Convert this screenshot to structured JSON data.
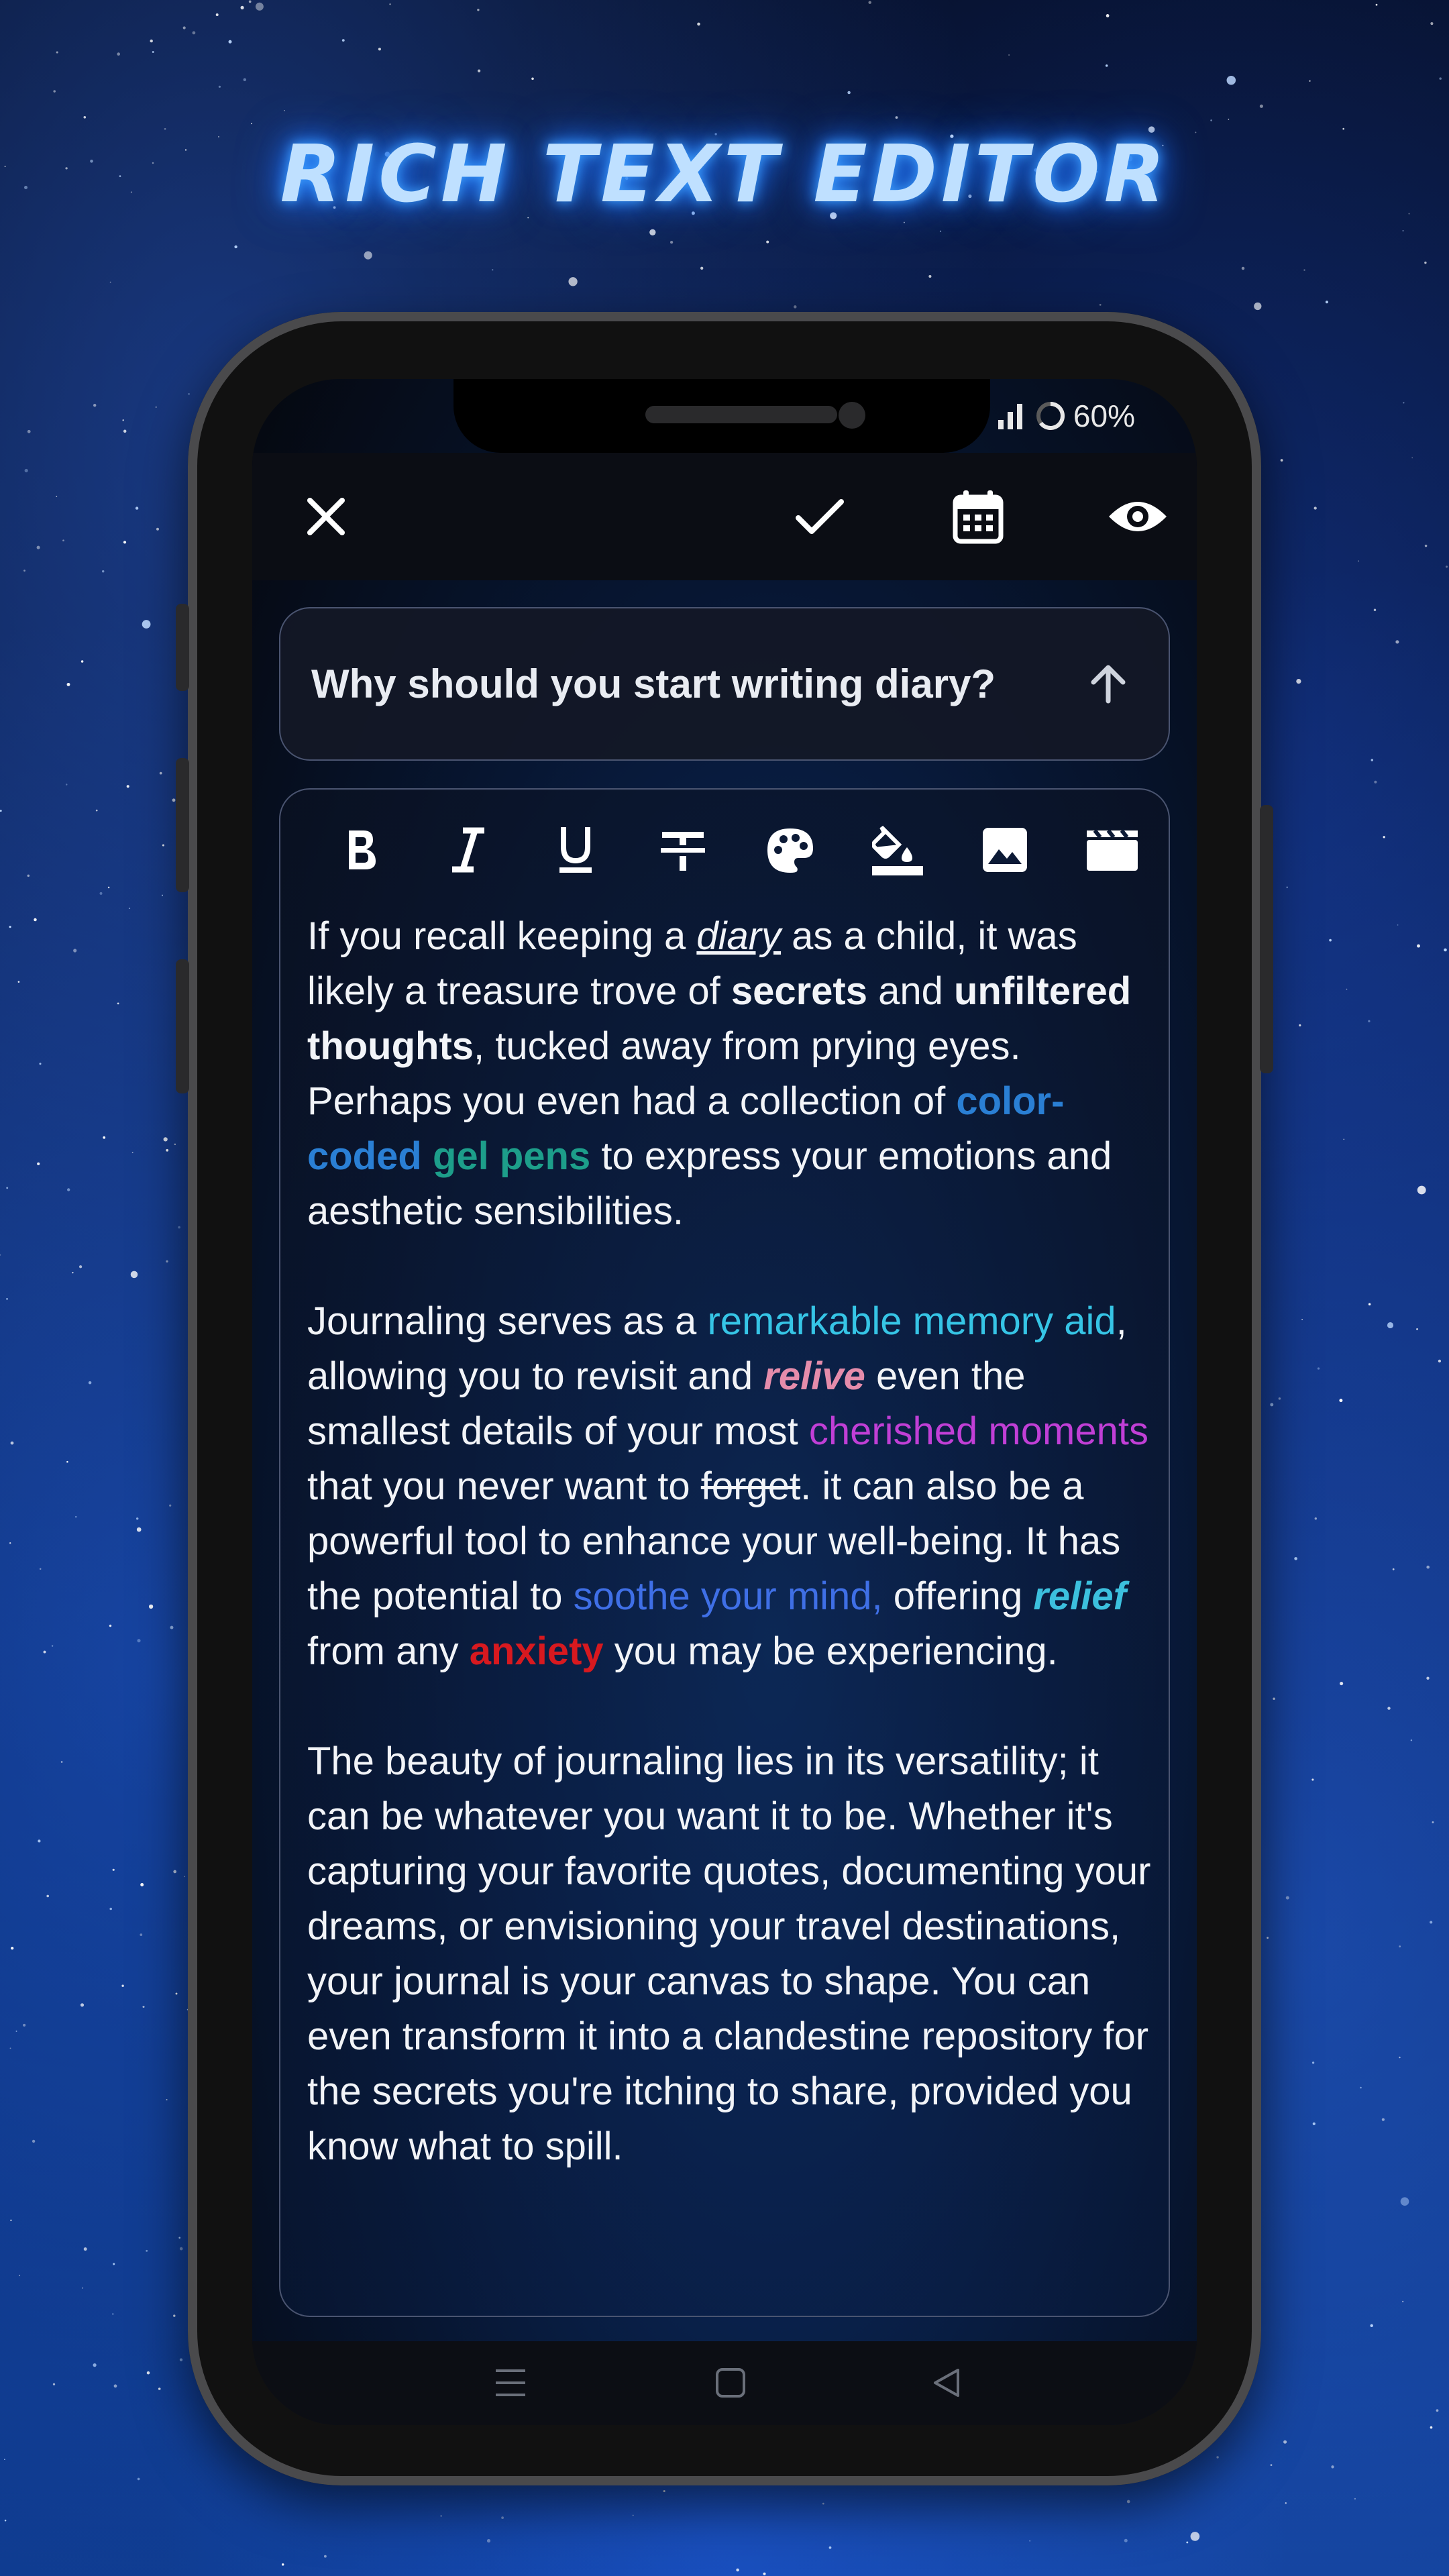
{
  "promo": {
    "title": "Rich Text Editor"
  },
  "status_bar": {
    "battery_percent": "60%"
  },
  "app_bar": {
    "close_icon": "close-icon",
    "save_icon": "checkmark-icon",
    "date_icon": "calendar-icon",
    "preview_icon": "eye-icon"
  },
  "entry": {
    "title": "Why should you start writing diary?"
  },
  "toolbar": {
    "buttons": [
      "bold",
      "italic",
      "underline",
      "strikethrough",
      "text-color",
      "highlight-color",
      "insert-image",
      "insert-video"
    ]
  },
  "content": {
    "p1": {
      "t1": "If you recall keeping a ",
      "diary": "diary",
      "t2": " as a child, it was likely a treasure trove of ",
      "secrets": "secrets",
      "t3": " and ",
      "unfiltered": "unfiltered thoughts",
      "t4": ", tucked away from prying eyes. Perhaps you even had a collection of ",
      "color_coded": "color-coded",
      "t5": " ",
      "gel_pens": "gel pens",
      "t6": " to express your emotions and aesthetic sensibilities."
    },
    "p2": {
      "t1": "Journaling serves as a ",
      "memory_aid": "remarkable memory aid",
      "t2": ", allowing you to revisit and ",
      "relive": "relive",
      "t3": " even the smallest details of your most ",
      "cherished": "cherished moments",
      "t4": " that you never want to ",
      "forget": "forget",
      "t5": ". it can also be a powerful tool to enhance your well-being. It has the potential to ",
      "soothe": "soothe your mind,",
      "t6": " offering ",
      "relief": "relief",
      "t7": " from any ",
      "anxiety": "anxiety",
      "t8": " you may be experiencing."
    },
    "p3": {
      "text": "The beauty of journaling lies in its versatility; it can be whatever you want it to be. Whether it's capturing your favorite quotes, documenting your dreams, or envisioning your travel destinations, your journal is your canvas to shape. You can even transform it into a clandestine repository for the secrets you're itching to share, provided you know what to spill."
    }
  },
  "colors": {
    "color_coded": "#2a7fd4",
    "gel_pens": "#1d9e8a",
    "memory_aid": "#36c5e6",
    "relive": "#e58cab",
    "cherished": "#c13fd6",
    "soothe": "#3f6fe6",
    "relief": "#3cc0de",
    "anxiety": "#d8191f",
    "title_glow": "#3ea0ff"
  }
}
